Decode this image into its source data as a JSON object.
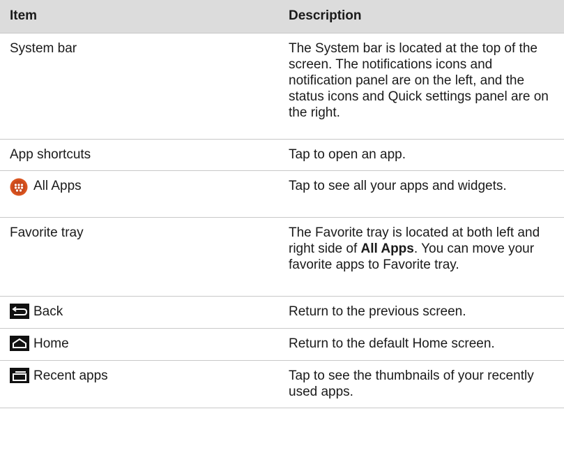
{
  "table": {
    "headers": {
      "item": "Item",
      "description": "Description"
    },
    "rows": [
      {
        "item": "System bar",
        "icon": "",
        "description": "The System bar is located at the top of the screen. The notifications icons and notification panel are on the left, and the status icons and Quick settings panel are on the right."
      },
      {
        "item": "App shortcuts",
        "icon": "",
        "description": "Tap to open an app."
      },
      {
        "item": "All Apps",
        "icon": "all-apps-icon",
        "description": "Tap to see all your apps and widgets."
      },
      {
        "item": "Favorite tray",
        "icon": "",
        "description_parts": {
          "before": "The Favorite tray is located at both left and right side of ",
          "bold": "All Apps",
          "after": ". You can move your favorite apps to Favorite tray."
        }
      },
      {
        "item": "Back",
        "icon": "back-icon",
        "description": "Return to the previous screen."
      },
      {
        "item": "Home",
        "icon": "home-icon",
        "description": "Return to the default Home screen."
      },
      {
        "item": "Recent apps",
        "icon": "recent-apps-icon",
        "description": "Tap to see the thumbnails of your recently used apps."
      }
    ]
  },
  "colors": {
    "header_bg": "#dcdcdc",
    "rule": "#c8c8c8",
    "all_apps_icon": "#d9531e"
  }
}
